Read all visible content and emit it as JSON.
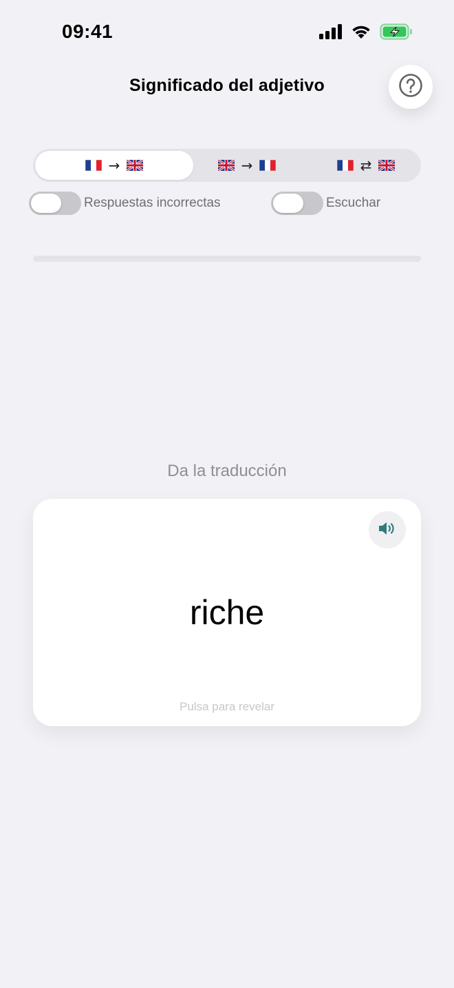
{
  "status_bar": {
    "time": "09:41"
  },
  "header": {
    "title": "Significado del adjetivo",
    "help_icon": "question-circle-icon"
  },
  "direction_modes": [
    {
      "from_flag": "france-flag-icon",
      "arrow": "→",
      "to_flag": "uk-flag-icon",
      "selected": true
    },
    {
      "from_flag": "uk-flag-icon",
      "arrow": "→",
      "to_flag": "france-flag-icon",
      "selected": false
    },
    {
      "from_flag": "france-flag-icon",
      "arrow": "⇄",
      "to_flag": "uk-flag-icon",
      "selected": false
    }
  ],
  "toggles": {
    "wrong_answers": {
      "label": "Respuestas incorrectas",
      "on": false
    },
    "listen": {
      "label": "Escuchar",
      "on": false
    }
  },
  "progress": {
    "value": 0
  },
  "quiz": {
    "instruction": "Da la traducción",
    "word": "riche",
    "hint": "Pulsa para revelar",
    "speaker_icon": "speaker-volume-icon"
  },
  "colors": {
    "accent": "#2f7d7a",
    "background": "#f2f2f6"
  }
}
